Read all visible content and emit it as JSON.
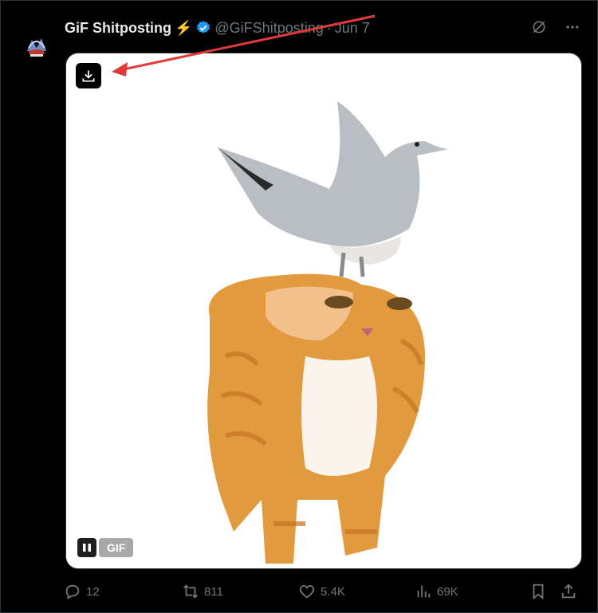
{
  "tweet": {
    "author_name": "GiF Shitposting",
    "emoji": "⚡",
    "handle": "@GiFShitposting",
    "separator": "·",
    "date": "Jun 7"
  },
  "media": {
    "badge": "GIF"
  },
  "actions": {
    "replies": "12",
    "reposts": "811",
    "likes": "5.4K",
    "views": "69K"
  },
  "icons": {
    "verified": "verified-badge-icon",
    "grok": "grok-icon",
    "more": "more-icon",
    "download": "download-icon",
    "pause": "pause-icon",
    "reply": "reply-icon",
    "repost": "repost-icon",
    "like": "heart-icon",
    "views": "views-icon",
    "bookmark": "bookmark-icon",
    "share": "share-icon"
  },
  "colors": {
    "verified": "#1d9bf0",
    "annotation_arrow": "#e03b3b",
    "muted": "#71767b"
  }
}
